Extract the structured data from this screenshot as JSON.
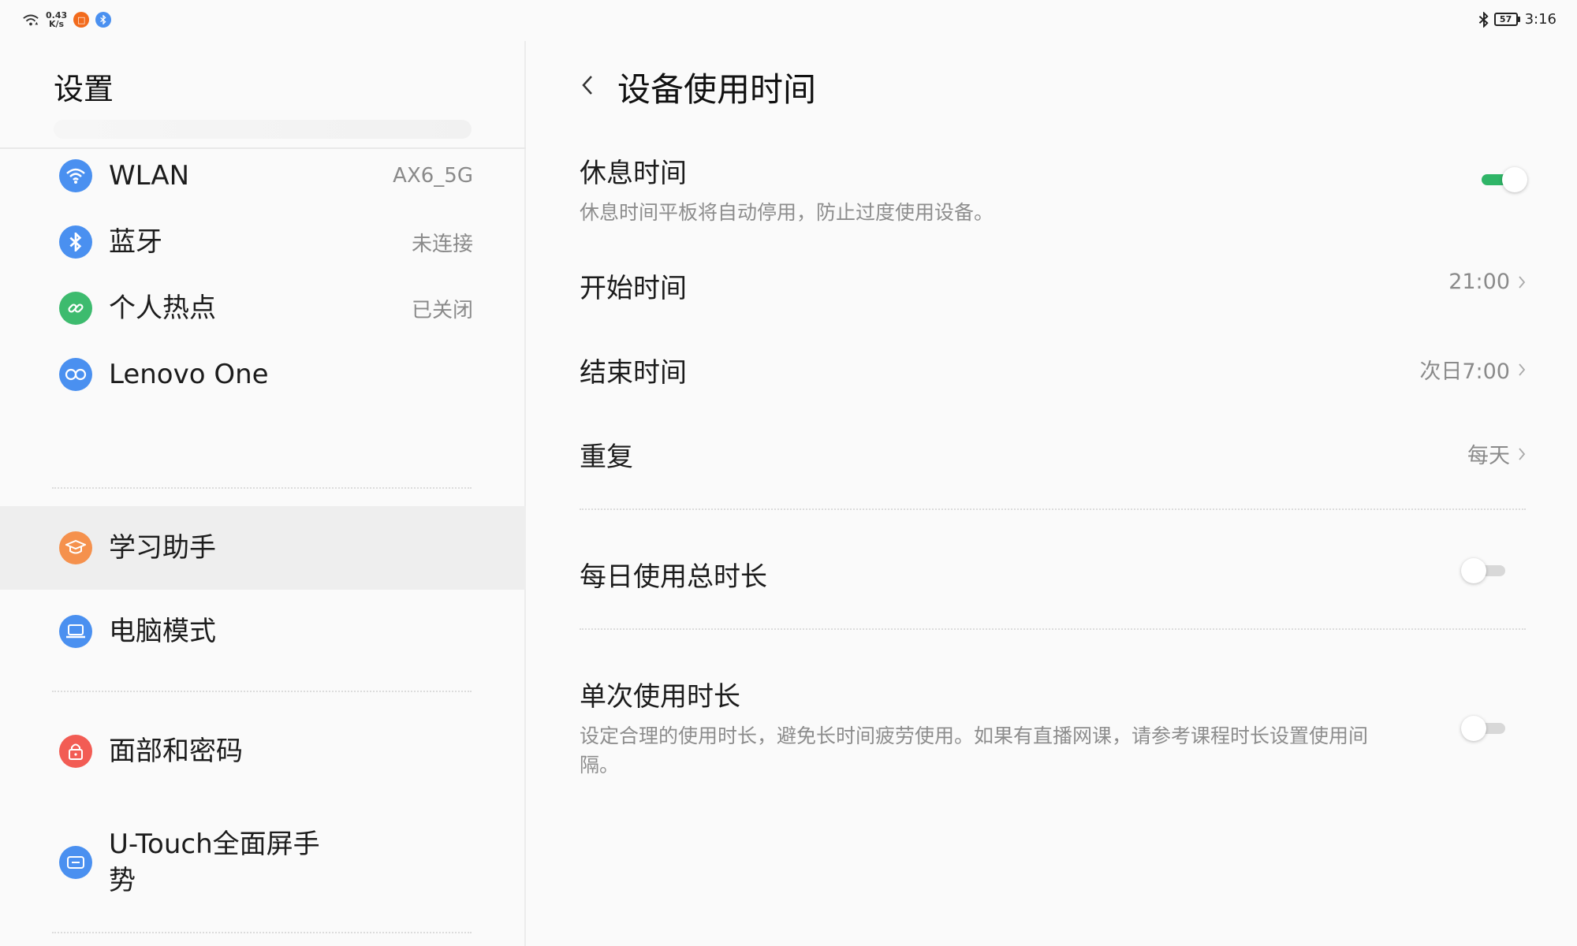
{
  "status_bar": {
    "net_speed_value": "0.43",
    "net_speed_unit": "K/s",
    "battery": "57",
    "time": "3:16"
  },
  "sidebar": {
    "title": "设置",
    "items": [
      {
        "label": "WLAN",
        "value": "AX6_5G",
        "icon": "wifi-icon",
        "color": "#4a90f0"
      },
      {
        "label": "蓝牙",
        "value": "未连接",
        "icon": "bluetooth-icon",
        "color": "#4a90f0"
      },
      {
        "label": "个人热点",
        "value": "已关闭",
        "icon": "link-icon",
        "color": "#3dbb6e"
      },
      {
        "label": "Lenovo One",
        "value": "",
        "icon": "infinity-icon",
        "color": "#4a90f0"
      },
      {
        "label": "学习助手",
        "value": "",
        "icon": "graduation-cap-icon",
        "color": "#f5914d"
      },
      {
        "label": "电脑模式",
        "value": "",
        "icon": "laptop-icon",
        "color": "#4a90f0"
      },
      {
        "label": "面部和密码",
        "value": "",
        "icon": "lock-icon",
        "color": "#f25c54"
      },
      {
        "label": "U-Touch全面屏手势",
        "value": "",
        "icon": "gesture-icon",
        "color": "#4a90f0"
      }
    ]
  },
  "main": {
    "title": "设备使用时间",
    "rest_time": {
      "title": "休息时间",
      "subtitle": "休息时间平板将自动停用，防止过度使用设备。",
      "enabled": true
    },
    "start_time": {
      "title": "开始时间",
      "value": "21:00"
    },
    "end_time": {
      "title": "结束时间",
      "value": "次日7:00"
    },
    "repeat": {
      "title": "重复",
      "value": "每天"
    },
    "daily_total": {
      "title": "每日使用总时长",
      "enabled": false
    },
    "single_use": {
      "title": "单次使用时长",
      "subtitle": "设定合理的使用时长，避免长时间疲劳使用。如果有直播网课，请参考课程时长设置使用间隔。",
      "enabled": false
    }
  },
  "colors": {
    "accent_green": "#2fb567",
    "active_bg": "#eeeeee"
  }
}
